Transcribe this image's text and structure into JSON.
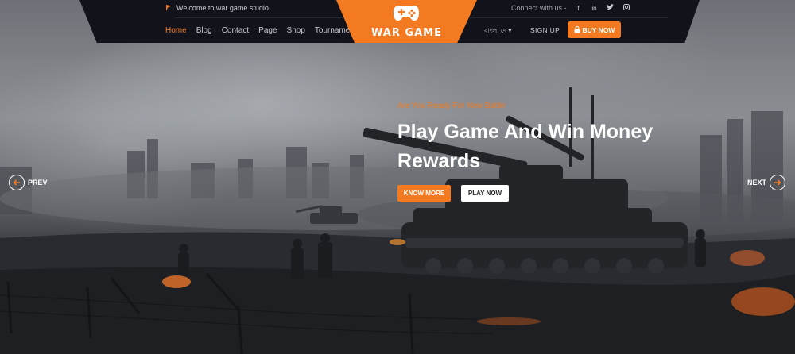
{
  "topbar": {
    "welcome_text": "Welcome to war game studio",
    "connect_text": "Connect with us -",
    "social_icons": [
      {
        "name": "facebook-icon",
        "glyph": "f"
      },
      {
        "name": "linkedin-icon",
        "glyph": "in"
      },
      {
        "name": "twitter-icon",
        "glyph": "🐦"
      },
      {
        "name": "instagram-icon",
        "glyph": "◎"
      }
    ]
  },
  "nav": {
    "items": [
      "Home",
      "Blog",
      "Contact",
      "Page",
      "Shop",
      "Tournament"
    ],
    "active": "Home"
  },
  "logo": {
    "text": "WAR GAME"
  },
  "actions": {
    "language": "বাংলা দে ▾",
    "signup": "SIGN UP",
    "buy_now": "BUY NOW"
  },
  "hero": {
    "tagline": "Are You Ready For New Battle",
    "headline": "Play Game And Win Money Rewards",
    "know_more": "KNOW MORE",
    "play_now": "PLAY NOW"
  },
  "slider": {
    "prev_label": "PREV",
    "next_label": "NEXT"
  },
  "colors": {
    "accent": "#f47a21",
    "bar": "#12131a"
  }
}
